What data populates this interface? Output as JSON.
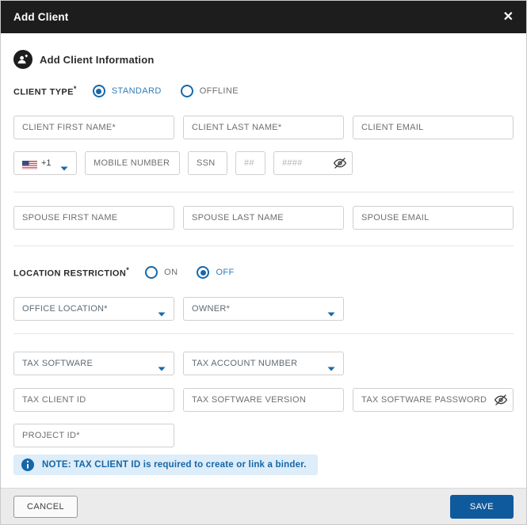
{
  "modal": {
    "title": "Add Client"
  },
  "section": {
    "title": "Add Client Information"
  },
  "client_type": {
    "label": "CLIENT TYPE",
    "required": "*",
    "options": [
      {
        "label": "STANDARD",
        "selected": true
      },
      {
        "label": "OFFLINE",
        "selected": false
      }
    ]
  },
  "location_restriction": {
    "label": "LOCATION RESTRICTION",
    "required": "*",
    "options": [
      {
        "label": "ON",
        "selected": false
      },
      {
        "label": "OFF",
        "selected": true
      }
    ]
  },
  "phone": {
    "country_code": "+1",
    "flag": "us-flag-icon"
  },
  "fields": {
    "client_first_name": "CLIENT FIRST NAME*",
    "client_last_name": "CLIENT LAST NAME*",
    "client_email": "CLIENT EMAIL",
    "mobile_number": "MOBILE NUMBER",
    "ssn": "SSN",
    "ssn_part2": "##",
    "ssn_part3": "####",
    "spouse_first_name": "SPOUSE FIRST NAME",
    "spouse_last_name": "SPOUSE LAST NAME",
    "spouse_email": "SPOUSE EMAIL",
    "office_location": "OFFICE LOCATION*",
    "owner": "OWNER*",
    "tax_software": "TAX SOFTWARE",
    "tax_account_number": "TAX ACCOUNT NUMBER",
    "tax_client_id": "TAX CLIENT ID",
    "tax_software_version": "TAX SOFTWARE VERSION",
    "tax_software_password": "TAX SOFTWARE PASSWORD",
    "project_id": "PROJECT ID*"
  },
  "note": {
    "text": "NOTE: TAX CLIENT ID is required to create or link a binder."
  },
  "footer": {
    "cancel": "CANCEL",
    "save": "SAVE"
  },
  "colors": {
    "accent": "#1568ab",
    "save_bg": "#0f5a9d",
    "header_bg": "#1d1d1d",
    "note_bg": "#ddedf9",
    "note_text": "#1566a7"
  }
}
